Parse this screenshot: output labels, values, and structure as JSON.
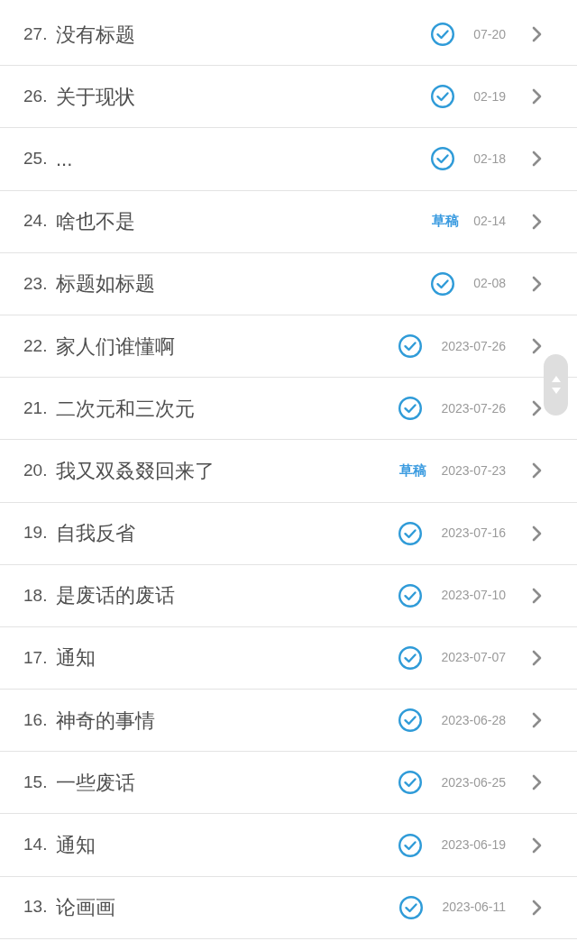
{
  "items": [
    {
      "number": "27.",
      "title": "没有标题",
      "kind": "published",
      "date": "07-20"
    },
    {
      "number": "26.",
      "title": "关于现状",
      "kind": "published",
      "date": "02-19"
    },
    {
      "number": "25.",
      "title": "...",
      "kind": "published",
      "date": "02-18"
    },
    {
      "number": "24.",
      "title": "啥也不是",
      "kind": "draft",
      "draft_label": "草稿",
      "date": "02-14"
    },
    {
      "number": "23.",
      "title": "标题如标题",
      "kind": "published",
      "date": "02-08"
    },
    {
      "number": "22.",
      "title": "家人们谁懂啊",
      "kind": "published",
      "date": "2023-07-26"
    },
    {
      "number": "21.",
      "title": "二次元和三次元",
      "kind": "published",
      "date": "2023-07-26"
    },
    {
      "number": "20.",
      "title": "我又双叒叕回来了",
      "kind": "draft",
      "draft_label": "草稿",
      "date": "2023-07-23"
    },
    {
      "number": "19.",
      "title": "自我反省",
      "kind": "published",
      "date": "2023-07-16"
    },
    {
      "number": "18.",
      "title": "是废话的废话",
      "kind": "published",
      "date": "2023-07-10"
    },
    {
      "number": "17.",
      "title": "通知",
      "kind": "published",
      "date": "2023-07-07"
    },
    {
      "number": "16.",
      "title": "神奇的事情",
      "kind": "published",
      "date": "2023-06-28"
    },
    {
      "number": "15.",
      "title": "一些废话",
      "kind": "published",
      "date": "2023-06-25"
    },
    {
      "number": "14.",
      "title": "通知",
      "kind": "published",
      "date": "2023-06-19"
    },
    {
      "number": "13.",
      "title": "论画画",
      "kind": "published",
      "date": "2023-06-11"
    }
  ]
}
